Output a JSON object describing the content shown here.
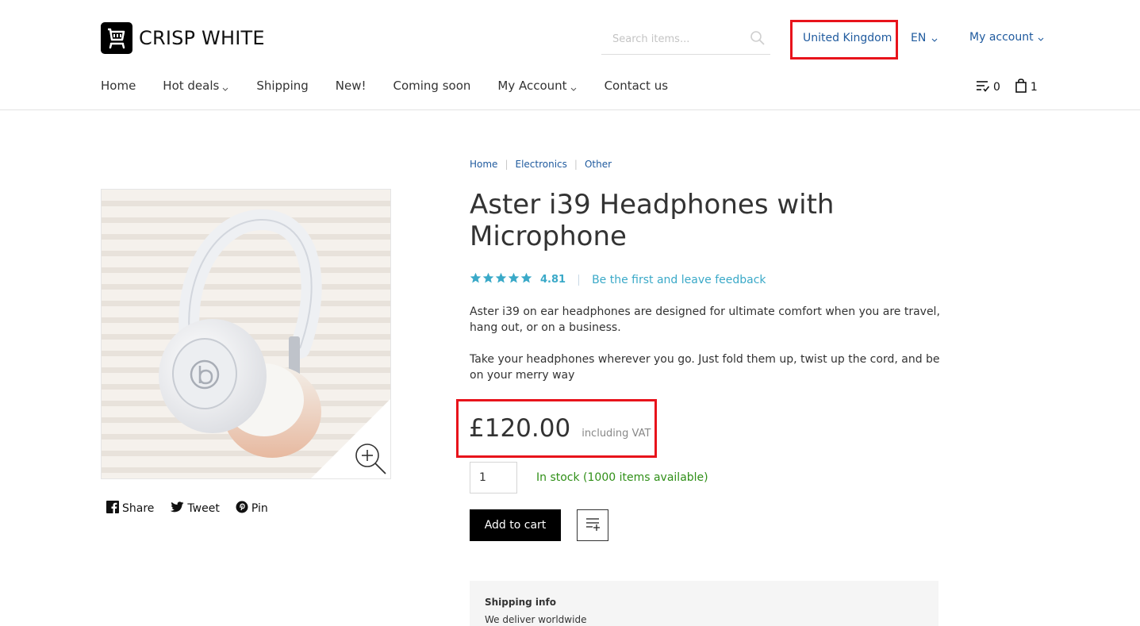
{
  "brand": {
    "name": "CRISP WHITE"
  },
  "search": {
    "placeholder": "Search items..."
  },
  "header": {
    "country": "United Kingdom",
    "language": "EN",
    "account": "My account"
  },
  "nav": {
    "items": [
      {
        "label": "Home",
        "dropdown": false
      },
      {
        "label": "Hot deals",
        "dropdown": true
      },
      {
        "label": "Shipping",
        "dropdown": false
      },
      {
        "label": "New!",
        "dropdown": false
      },
      {
        "label": "Coming soon",
        "dropdown": false
      },
      {
        "label": "My Account",
        "dropdown": true
      },
      {
        "label": "Contact us",
        "dropdown": false
      }
    ],
    "wishlist_count": "0",
    "cart_count": "1"
  },
  "breadcrumb": [
    "Home",
    "Electronics",
    "Other"
  ],
  "product": {
    "title": "Aster i39 Headphones with Microphone",
    "rating": "4.81",
    "feedback_link": "Be the first and leave feedback",
    "description": [
      "Aster i39 on ear headphones are designed for ultimate comfort when you are travel, hang out, or on a business.",
      "Take your headphones wherever you go. Just fold them up, twist up the cord, and be on your merry way"
    ],
    "price": "£120.00",
    "vat_note": "including VAT",
    "quantity": "1",
    "stock": "In stock (1000 items available)",
    "add_to_cart": "Add to cart"
  },
  "share": {
    "facebook": "Share",
    "twitter": "Tweet",
    "pinterest": "Pin"
  },
  "shipping": {
    "title": "Shipping info",
    "text": "We deliver worldwide"
  },
  "colors": {
    "link": "#1f5a9e",
    "accent": "#3aa9c8",
    "in_stock": "#2f8f17",
    "highlight": "#e8131b"
  }
}
